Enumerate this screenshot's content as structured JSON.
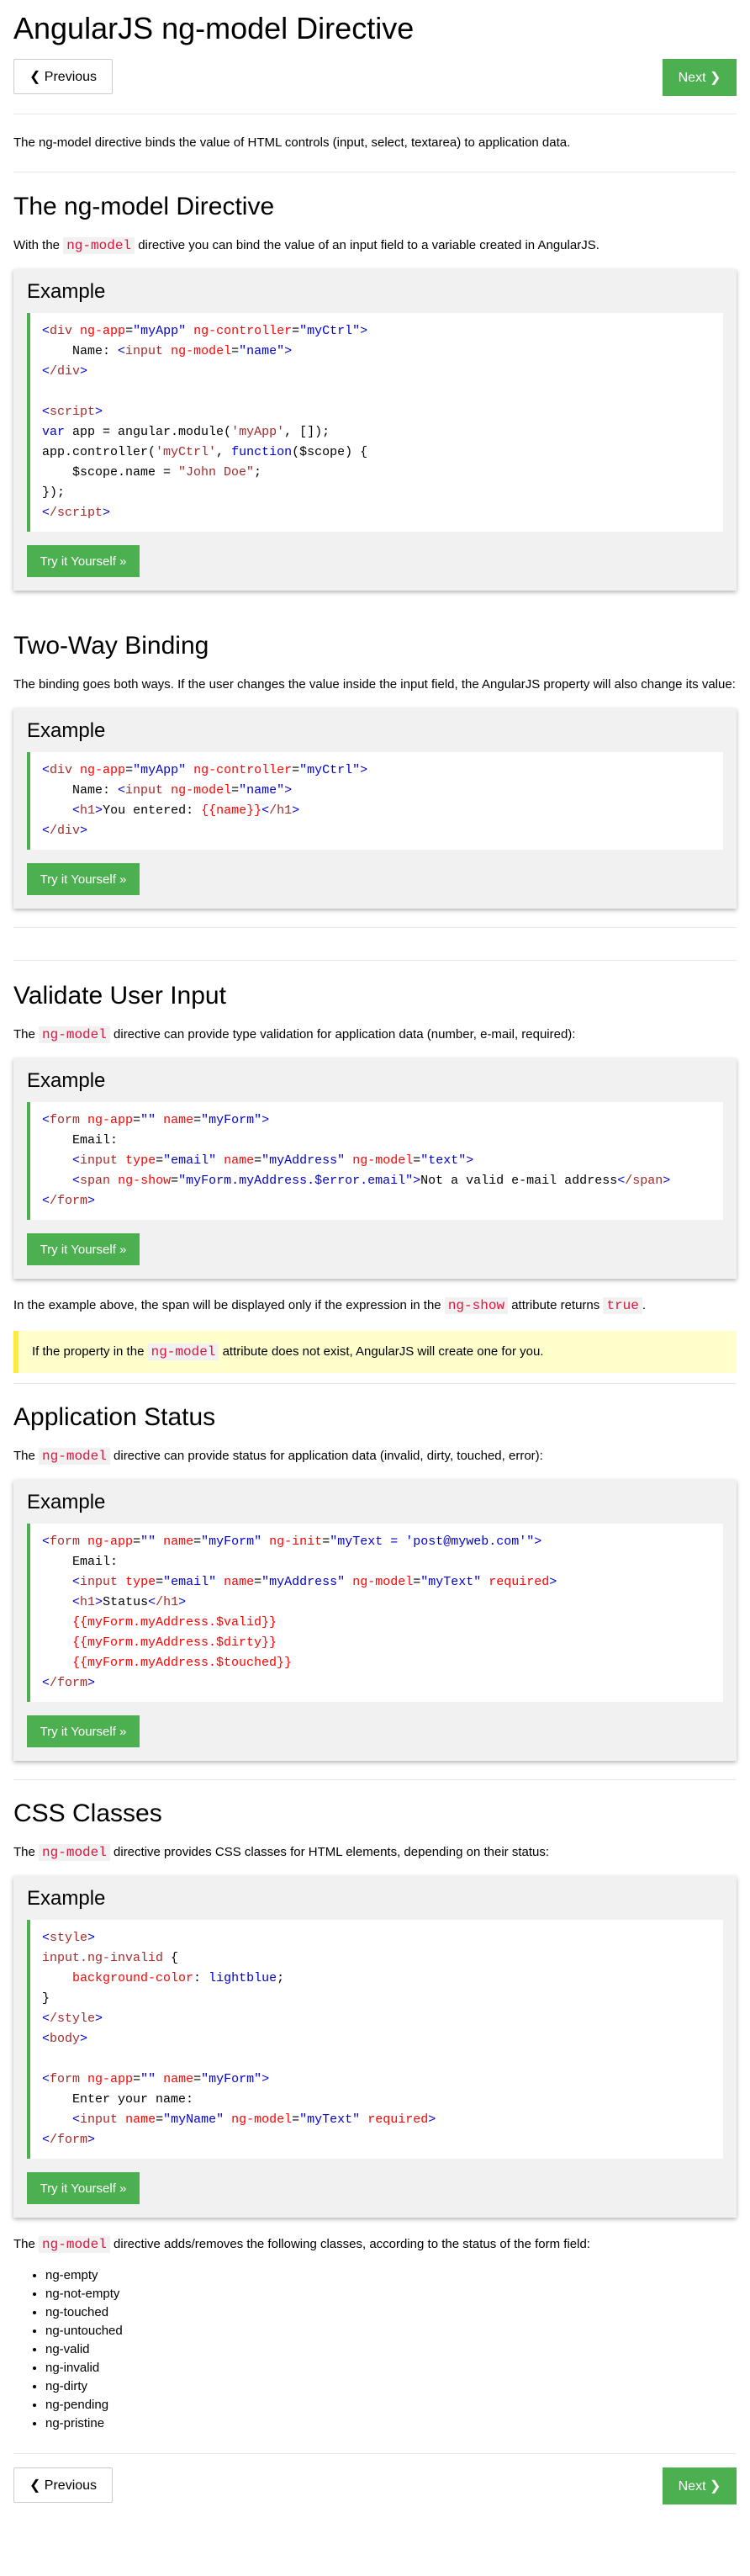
{
  "title": "AngularJS ng-model Directive",
  "nav": {
    "prev_label": "❮ Previous",
    "next_label": "Next ❯"
  },
  "intro": "The ng-model directive binds the value of HTML controls (input, select, textarea) to application data.",
  "sections": {
    "ngmodel": {
      "heading": "The ng-model Directive",
      "text_before": "With the",
      "keyword": "ng-model",
      "text_after": "directive you can bind the value of an input field to a variable created in AngularJS."
    },
    "twoway": {
      "heading": "Two-Way Binding",
      "text": "The binding goes both ways. If the user changes the value inside the input field, the AngularJS property will also change its value:"
    },
    "validate": {
      "heading": "Validate User Input",
      "text_before": "The",
      "keyword": "ng-model",
      "text_after": "directive can provide type validation for application data (number, e-mail, required):",
      "after_example_before": "In the example above, the span will be displayed only if the expression in the",
      "after_example_kw1": "ng-show",
      "after_example_mid": "attribute returns",
      "after_example_kw2": "true",
      "after_example_end": ".",
      "note_before": "If the property in the",
      "note_kw": "ng-model",
      "note_after": "attribute does not exist, AngularJS will create one for you."
    },
    "status": {
      "heading": "Application Status",
      "text_before": "The",
      "keyword": "ng-model",
      "text_after": "directive can provide status for application data (invalid, dirty, touched, error):"
    },
    "css": {
      "heading": "CSS Classes",
      "text_before": "The",
      "keyword": "ng-model",
      "text_after": "directive provides CSS classes for HTML elements, depending on their status:",
      "after_before": "The",
      "after_kw": "ng-model",
      "after_text": "directive adds/removes the following classes, according to the status of the form field:",
      "classes": [
        "ng-empty",
        "ng-not-empty",
        "ng-touched",
        "ng-untouched",
        "ng-valid",
        "ng-invalid",
        "ng-dirty",
        "ng-pending",
        "ng-pristine"
      ]
    }
  },
  "example_label": "Example",
  "try_label": "Try it Yourself »"
}
